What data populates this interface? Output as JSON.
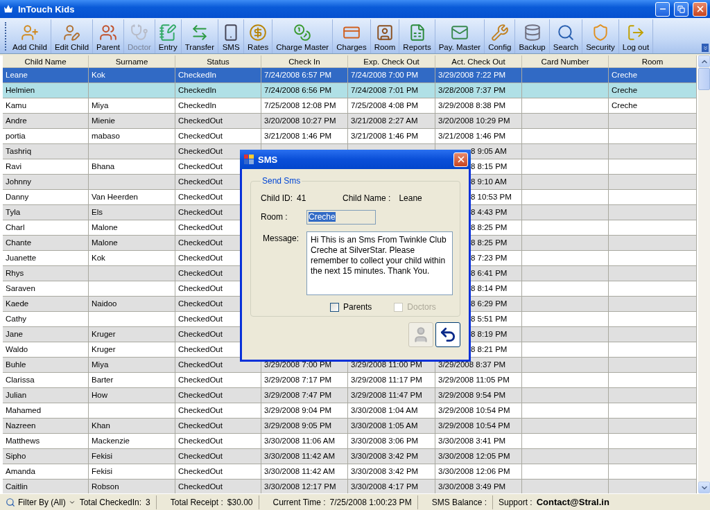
{
  "window": {
    "title": "InTouch Kids"
  },
  "toolbar": [
    {
      "label": "Add Child",
      "disabled": false
    },
    {
      "label": "Edit Child",
      "disabled": false
    },
    {
      "label": "Parent",
      "disabled": false
    },
    {
      "label": "Doctor",
      "disabled": true
    },
    {
      "label": "Entry",
      "disabled": false
    },
    {
      "label": "Transfer",
      "disabled": false
    },
    {
      "label": "SMS",
      "disabled": false
    },
    {
      "label": "Rates",
      "disabled": false
    },
    {
      "label": "Charge Master",
      "disabled": false
    },
    {
      "label": "Charges",
      "disabled": false
    },
    {
      "label": "Room",
      "disabled": false
    },
    {
      "label": "Reports",
      "disabled": false
    },
    {
      "label": "Pay. Master",
      "disabled": false
    },
    {
      "label": "Config",
      "disabled": false
    },
    {
      "label": "Backup",
      "disabled": false
    },
    {
      "label": "Search",
      "disabled": false
    },
    {
      "label": "Security",
      "disabled": false
    },
    {
      "label": "Log out",
      "disabled": false
    }
  ],
  "table": {
    "columns": [
      "Child Name",
      "Surname",
      "Status",
      "Check In",
      "Exp. Check Out",
      "Act. Check Out",
      "Card Number",
      "Room"
    ],
    "rows": [
      {
        "child_name": "Leane",
        "surname": "Kok",
        "status": "CheckedIn",
        "check_in": "7/24/2008 6:57 PM",
        "exp_check_out": "7/24/2008 7:00 PM",
        "act_check_out": "3/29/2008 7:22 PM",
        "room": "Creche",
        "selected": true,
        "highlighted": false
      },
      {
        "child_name": "Helmien",
        "status": "CheckedIn",
        "check_in": "7/24/2008 6:56 PM",
        "exp_check_out": "7/24/2008 7:01 PM",
        "act_check_out": "3/28/2008 7:37 PM",
        "room": "Creche",
        "selected": false,
        "highlighted": true
      },
      {
        "child_name": "Kamu",
        "surname": "Miya",
        "status": "CheckedIn",
        "check_in": "7/25/2008 12:08 PM",
        "exp_check_out": "7/25/2008 4:08 PM",
        "act_check_out": "3/29/2008 8:38 PM",
        "room": "Creche",
        "selected": false,
        "highlighted": false
      },
      {
        "child_name": "Andre",
        "surname": "Mienie",
        "status": "CheckedOut",
        "check_in": "3/20/2008 10:27 PM",
        "exp_check_out": "3/21/2008 2:27 AM",
        "act_check_out": "3/20/2008 10:29 PM",
        "selected": false,
        "highlighted": false
      },
      {
        "child_name": "portia",
        "surname": "mabaso",
        "status": "CheckedOut",
        "check_in": "3/21/2008 1:46 PM",
        "exp_check_out": "3/21/2008 1:46 PM",
        "act_check_out": "3/21/2008 1:46 PM",
        "selected": false,
        "highlighted": false
      },
      {
        "child_name": "Tashriq",
        "status": "CheckedOut",
        "act_check_out": "8 9:05 AM",
        "selected": false,
        "highlighted": false
      },
      {
        "child_name": "Ravi",
        "surname": "Bhana",
        "status": "CheckedOut",
        "act_check_out": "8 8:15 PM",
        "selected": false,
        "highlighted": false
      },
      {
        "child_name": "Johnny",
        "status": "CheckedOut",
        "act_check_out": "8 9:10 AM",
        "selected": false,
        "highlighted": false
      },
      {
        "child_name": "Danny",
        "surname": "Van Heerden",
        "status": "CheckedOut",
        "act_check_out": "8 10:53 PM",
        "selected": false,
        "highlighted": false
      },
      {
        "child_name": "Tyla",
        "surname": "Els",
        "status": "CheckedOut",
        "act_check_out": "8 4:43 PM",
        "selected": false,
        "highlighted": false
      },
      {
        "child_name": "Charl",
        "surname": "Malone",
        "status": "CheckedOut",
        "act_check_out": "8 8:25 PM",
        "selected": false,
        "highlighted": false
      },
      {
        "child_name": "Chante",
        "surname": "Malone",
        "status": "CheckedOut",
        "act_check_out": "8 8:25 PM",
        "selected": false,
        "highlighted": false
      },
      {
        "child_name": "Juanette",
        "surname": "Kok",
        "status": "CheckedOut",
        "act_check_out": "8 7:23 PM",
        "selected": false,
        "highlighted": false
      },
      {
        "child_name": "Rhys",
        "status": "CheckedOut",
        "act_check_out": "8 6:41 PM",
        "selected": false,
        "highlighted": false
      },
      {
        "child_name": "Saraven",
        "status": "CheckedOut",
        "act_check_out": "8 8:14 PM",
        "selected": false,
        "highlighted": false
      },
      {
        "child_name": "Kaede",
        "surname": "Naidoo",
        "status": "CheckedOut",
        "act_check_out": "8 6:29 PM",
        "selected": false,
        "highlighted": false
      },
      {
        "child_name": "Cathy",
        "status": "CheckedOut",
        "act_check_out": "8 5:51 PM",
        "selected": false,
        "highlighted": false
      },
      {
        "child_name": "Jane",
        "surname": "Kruger",
        "status": "CheckedOut",
        "act_check_out": "8 8:19 PM",
        "selected": false,
        "highlighted": false
      },
      {
        "child_name": "Waldo",
        "surname": "Kruger",
        "status": "CheckedOut",
        "act_check_out": "8 8:21 PM",
        "selected": false,
        "highlighted": false
      },
      {
        "child_name": "Buhle",
        "surname": "Miya",
        "status": "CheckedOut",
        "check_in": "3/29/2008 7:00 PM",
        "exp_check_out": "3/29/2008 11:00 PM",
        "act_check_out": "3/29/2008 8:37 PM",
        "selected": false,
        "highlighted": false
      },
      {
        "child_name": "Clarissa",
        "surname": "Barter",
        "status": "CheckedOut",
        "check_in": "3/29/2008 7:17 PM",
        "exp_check_out": "3/29/2008 11:17 PM",
        "act_check_out": "3/29/2008 11:05 PM",
        "selected": false,
        "highlighted": false
      },
      {
        "child_name": "Julian",
        "surname": "How",
        "status": "CheckedOut",
        "check_in": "3/29/2008 7:47 PM",
        "exp_check_out": "3/29/2008 11:47 PM",
        "act_check_out": "3/29/2008 9:54 PM",
        "selected": false,
        "highlighted": false
      },
      {
        "child_name": "Mahamed",
        "status": "CheckedOut",
        "check_in": "3/29/2008 9:04 PM",
        "exp_check_out": "3/30/2008 1:04 AM",
        "act_check_out": "3/29/2008 10:54 PM",
        "selected": false,
        "highlighted": false
      },
      {
        "child_name": "Nazreen",
        "surname": "Khan",
        "status": "CheckedOut",
        "check_in": "3/29/2008 9:05 PM",
        "exp_check_out": "3/30/2008 1:05 AM",
        "act_check_out": "3/29/2008 10:54 PM",
        "selected": false,
        "highlighted": false
      },
      {
        "child_name": "Matthews",
        "surname": "Mackenzie",
        "status": "CheckedOut",
        "check_in": "3/30/2008 11:06 AM",
        "exp_check_out": "3/30/2008 3:06 PM",
        "act_check_out": "3/30/2008 3:41 PM",
        "selected": false,
        "highlighted": false
      },
      {
        "child_name": "Sipho",
        "surname": "Fekisi",
        "status": "CheckedOut",
        "check_in": "3/30/2008 11:42 AM",
        "exp_check_out": "3/30/2008 3:42 PM",
        "act_check_out": "3/30/2008 12:05 PM",
        "selected": false,
        "highlighted": false
      },
      {
        "child_name": "Amanda",
        "surname": "Fekisi",
        "status": "CheckedOut",
        "check_in": "3/30/2008 11:42 AM",
        "exp_check_out": "3/30/2008 3:42 PM",
        "act_check_out": "3/30/2008 12:06 PM",
        "selected": false,
        "highlighted": false
      },
      {
        "child_name": "Caitlin",
        "surname": "Robson",
        "status": "CheckedOut",
        "check_in": "3/30/2008 12:17 PM",
        "exp_check_out": "3/30/2008 4:17 PM",
        "act_check_out": "3/30/2008 3:49 PM",
        "selected": false,
        "highlighted": false
      }
    ]
  },
  "dialog": {
    "title": "SMS",
    "group": "Send Sms",
    "child_id_label": "Child ID:",
    "child_id": "41",
    "child_name_label": "Child Name :",
    "child_name": "Leane",
    "room_label": "Room :",
    "room": "Creche",
    "message_label": "Message:",
    "message": "Hi This is an Sms From Twinkle Club Creche at SilverStar. Please remember to collect your child within the next 15 minutes. Thank You.",
    "checkboxes": [
      {
        "label": "Parents",
        "checked": false,
        "disabled": false
      },
      {
        "label": "Doctors",
        "checked": false,
        "disabled": true
      }
    ],
    "send_disabled": true
  },
  "status_bar": {
    "filter": "Filter By (All)",
    "checked_in_label": "Total CheckedIn:",
    "checked_in": "3",
    "receipt_label": "Total Receipt :",
    "receipt": "$30.00",
    "time_label": "Current Time :",
    "time": "7/25/2008 1:00:23 PM",
    "sms_label": "SMS Balance :",
    "support_label": "Support :",
    "support": "Contact@Stral.in"
  }
}
